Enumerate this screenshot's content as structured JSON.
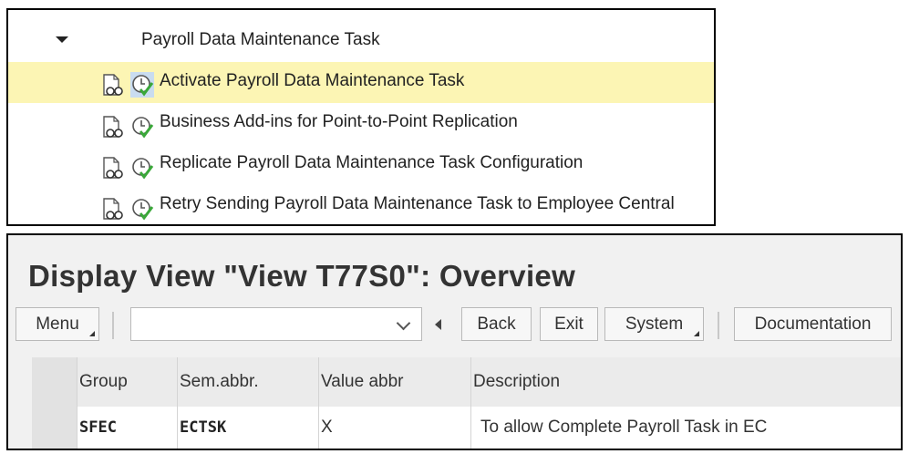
{
  "tree": {
    "root_label": "Payroll Data Maintenance Task",
    "items": [
      {
        "label": "Activate Payroll Data Maintenance Task"
      },
      {
        "label": "Business Add-ins for Point-to-Point Replication"
      },
      {
        "label": "Replicate Payroll Data Maintenance Task Configuration"
      },
      {
        "label": "Retry Sending Payroll Data Maintenance Task to Employee Central"
      }
    ]
  },
  "view": {
    "title": "Display View \"View T77S0\": Overview",
    "toolbar": {
      "menu_label": "Menu",
      "command_value": "",
      "back_label": "Back",
      "exit_label": "Exit",
      "system_label": "System",
      "documentation_label": "Documentation"
    },
    "table": {
      "columns": [
        "Group",
        "Sem.abbr.",
        "Value abbr",
        "Description"
      ],
      "rows": [
        {
          "group": "SFEC",
          "sem_abbr": "ECTSK",
          "value_abbr": "X",
          "description": "To allow Complete Payroll Task in EC"
        }
      ]
    }
  },
  "colors": {
    "highlight_row": "#fcf5b4",
    "exec_check_green": "#3aa839"
  }
}
